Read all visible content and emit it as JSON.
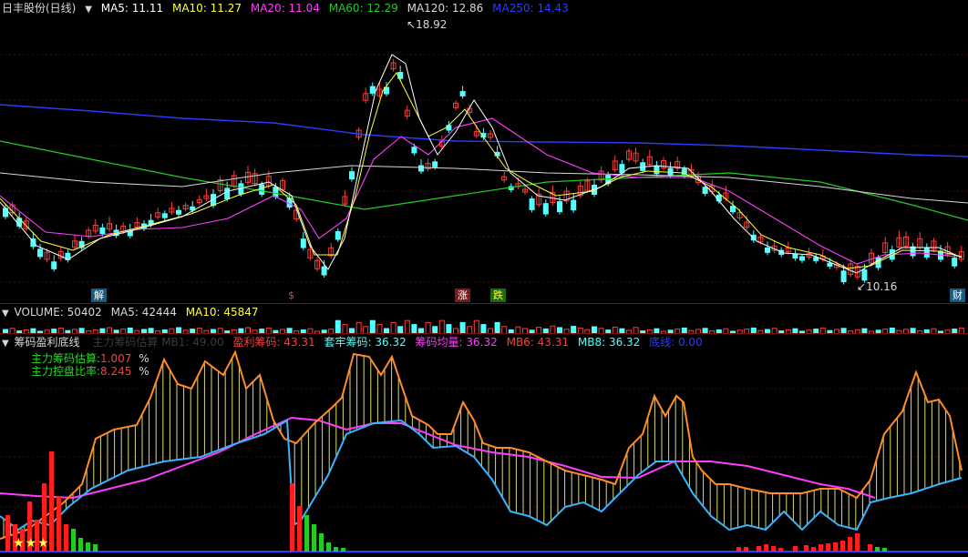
{
  "main": {
    "title": "日丰股份(日线)",
    "ma5": "MA5: 11.11",
    "ma10": "MA10: 11.27",
    "ma20": "MA20: 11.04",
    "ma60": "MA60: 12.29",
    "ma120": "MA120: 12.86",
    "ma250": "MA250: 14.43",
    "high_label": "18.92",
    "low_label": "10.16",
    "markers": [
      "解",
      "$",
      "涨",
      "跌",
      "财"
    ],
    "colors": {
      "ma5": "#ffffff",
      "ma10": "#ffff3c",
      "ma20": "#ff3cff",
      "ma60": "#22cc22",
      "ma120": "#d8d8d8",
      "ma250": "#2a3cff",
      "up": "#ff3c3c",
      "down": "#54ffff"
    }
  },
  "volume": {
    "label": "VOLUME: 50402",
    "ma5": "MA5: 42444",
    "ma10": "MA10: 45847"
  },
  "indicator": {
    "title": "筹码盈利底线",
    "faded_text": "主力筹码估算  MB1: 49.00",
    "profit_chip": "盈利筹码: 43.31",
    "trapped_chip": "套牢筹码: 36.32",
    "avg_chip": "筹码均量: 36.32",
    "mb6": "MB6: 43.31",
    "mb8": "MB8: 36.32",
    "bottom_line": "底线: 0.00",
    "main_chip_label": "主力筹码估算:",
    "main_chip_value": "1.007",
    "main_ctrl_label": "主力控盘比率:",
    "main_ctrl_value": "8.245",
    "pct": "%",
    "stars": "★★★"
  }
}
